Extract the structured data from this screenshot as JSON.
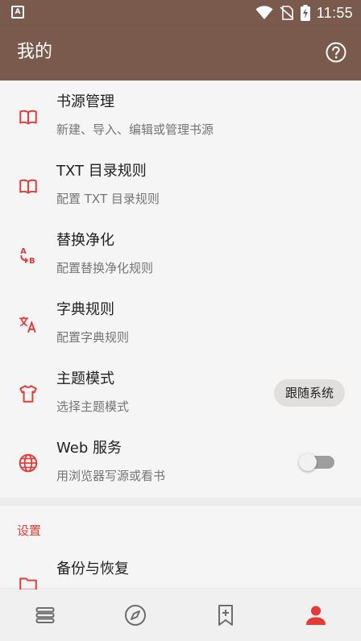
{
  "status_bar": {
    "time": "11:55",
    "left_icon_letter": "A"
  },
  "app_bar": {
    "title": "我的"
  },
  "menu_items": [
    {
      "title": "书源管理",
      "subtitle": "新建、导入、编辑或管理书源",
      "icon": "book-open-icon"
    },
    {
      "title": "TXT 目录规则",
      "subtitle": "配置 TXT 目录规则",
      "icon": "book-open-icon"
    },
    {
      "title": "替换净化",
      "subtitle": "配置替换净化规则",
      "icon": "find-replace-icon"
    },
    {
      "title": "字典规则",
      "subtitle": "配置字典规则",
      "icon": "translate-icon"
    },
    {
      "title": "主题模式",
      "subtitle": "选择主题模式",
      "icon": "shirt-icon",
      "value": "跟随系统"
    },
    {
      "title": "Web 服务",
      "subtitle": "用浏览器写源或看书",
      "icon": "globe-icon",
      "toggle": false
    }
  ],
  "settings_section": {
    "title": "设置",
    "items": [
      {
        "title": "备份与恢复",
        "icon": "folder-icon"
      }
    ]
  },
  "bottom_nav": [
    {
      "name": "bookshelf",
      "icon": "bookshelf-icon",
      "active": false
    },
    {
      "name": "explore",
      "icon": "compass-icon",
      "active": false
    },
    {
      "name": "rss",
      "icon": "bookmark-add-icon",
      "active": false
    },
    {
      "name": "my",
      "icon": "person-icon",
      "active": true
    }
  ],
  "colors": {
    "primary": "#7a5a4c",
    "accent": "#e53935",
    "background": "#f5f5f5",
    "nav_icon": "#6d6d6d"
  }
}
